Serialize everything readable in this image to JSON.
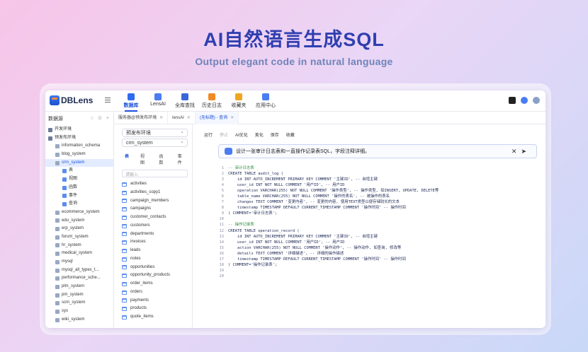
{
  "hero": {
    "title": "AI自然语言生成SQL",
    "subtitle": "Output elegant code in natural language"
  },
  "app": {
    "logo_text": "DBLens",
    "nav": [
      {
        "label": "数据库",
        "icon": "database-icon",
        "color": "#2f6bf0",
        "active": true
      },
      {
        "label": "LensAI",
        "icon": "ai-icon",
        "color": "#4a7cf2"
      },
      {
        "label": "全库查找",
        "icon": "search-db-icon",
        "color": "#3a66d8"
      },
      {
        "label": "历史日志",
        "icon": "history-icon",
        "color": "#f08a24"
      },
      {
        "label": "收藏夹",
        "icon": "star-folder-icon",
        "color": "#f0a623"
      },
      {
        "label": "应用中心",
        "icon": "app-center-icon",
        "color": "#4a7cf2"
      }
    ]
  },
  "left": {
    "title": "数据源",
    "tree": [
      {
        "label": "开发环境",
        "indent": 0
      },
      {
        "label": "预发布环境",
        "indent": 0
      },
      {
        "label": "information_schema",
        "indent": 1
      },
      {
        "label": "blog_system",
        "indent": 1
      },
      {
        "label": "crm_system",
        "indent": 1,
        "selected": true
      },
      {
        "label": "表",
        "indent": 2
      },
      {
        "label": "视图",
        "indent": 2
      },
      {
        "label": "函数",
        "indent": 2
      },
      {
        "label": "事件",
        "indent": 2
      },
      {
        "label": "查询",
        "indent": 2
      },
      {
        "label": "ecommerce_system",
        "indent": 1
      },
      {
        "label": "edu_system",
        "indent": 1
      },
      {
        "label": "erp_system",
        "indent": 1
      },
      {
        "label": "forum_system",
        "indent": 1
      },
      {
        "label": "hr_system",
        "indent": 1
      },
      {
        "label": "medical_system",
        "indent": 1
      },
      {
        "label": "mysql",
        "indent": 1
      },
      {
        "label": "mysql_all_types_t...",
        "indent": 1
      },
      {
        "label": "performance_sche...",
        "indent": 1
      },
      {
        "label": "plm_system",
        "indent": 1
      },
      {
        "label": "pm_system",
        "indent": 1
      },
      {
        "label": "scm_system",
        "indent": 1
      },
      {
        "label": "sys",
        "indent": 1
      },
      {
        "label": "wiki_system",
        "indent": 1
      }
    ]
  },
  "tabs": [
    {
      "label": "服务器@预发布环境"
    },
    {
      "label": "lensAI"
    },
    {
      "label": "(无标题) - 查询",
      "active": true
    }
  ],
  "middle": {
    "env_select": "预发布环境",
    "db_select": "crm_system",
    "sub_tabs": [
      "表",
      "视图",
      "函数",
      "事件"
    ],
    "search_placeholder": "请输入",
    "tables": [
      "activities",
      "activities_copy1",
      "campaign_members",
      "campaigns",
      "customer_contacts",
      "customers",
      "departments",
      "invoices",
      "leads",
      "notes",
      "opportunities",
      "opportunity_products",
      "order_items",
      "orders",
      "payments",
      "products",
      "quote_items"
    ]
  },
  "editor": {
    "toolbar": [
      "运行",
      "停止",
      "AI优化",
      "美化",
      "保存",
      "收藏"
    ],
    "prompt_text": "设计一张审计日志表和一直操作记录表SQL，字段注释详细。",
    "code": [
      "-- 审计日志表",
      "CREATE TABLE audit_log (",
      "    id INT AUTO_INCREMENT PRIMARY KEY COMMENT '主键ID', -- 自增主键",
      "    user_id INT NOT NULL COMMENT '用户ID', -- 用户ID",
      "    operation VARCHAR(255) NOT NULL COMMENT '操作类型', -- 操作类型, 如INSERT, UPDATE, DELETE等",
      "    table_name VARCHAR(255) NOT NULL COMMENT '操作的表名', -- 被操作的表名",
      "    changes TEXT COMMENT '变更内容', -- 变更的内容, 使用TEXT类型以便存储较长的文本",
      "    timestamp TIMESTAMP DEFAULT CURRENT_TIMESTAMP COMMENT '操作时间' -- 操作时间",
      ") COMMENT='审计日志表';",
      "",
      "-- 操作记录表",
      "CREATE TABLE operation_record (",
      "    id INT AUTO_INCREMENT PRIMARY KEY COMMENT '主键ID', -- 自增主键",
      "    user_id INT NOT NULL COMMENT '用户ID', -- 用户ID",
      "    action VARCHAR(255) NOT NULL COMMENT '操作动作', -- 操作动作, 如查询, 修改等",
      "    details TEXT COMMENT '详细描述', -- 详细的操作描述",
      "    timestamp TIMESTAMP DEFAULT CURRENT_TIMESTAMP COMMENT '操作时间' -- 操作时间",
      ") COMMENT='操作记录表';",
      "",
      ""
    ]
  }
}
